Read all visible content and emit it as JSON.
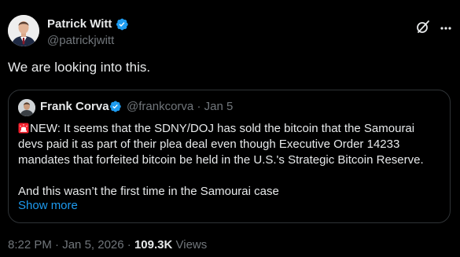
{
  "author": {
    "name": "Patrick Witt",
    "handle": "@patrickjwitt",
    "verified_icon": "verified-badge-icon",
    "avatar_icon": "avatar"
  },
  "header_actions": {
    "grok_icon": "grok-icon",
    "more_icon": "more-icon"
  },
  "tweet": {
    "text": "We are looking into this."
  },
  "quote": {
    "name": "Frank Corva",
    "handle": "@frankcorva",
    "separator": "·",
    "date": "Jan 5",
    "lines": [
      "NEW: It seems that the SDNY/DOJ has sold the bitcoin that the Samourai",
      "devs paid it as part of their plea deal even though Executive Order 14233",
      "mandates that forfeited bitcoin be held in the U.S.'s Strategic Bitcoin Reserve."
    ],
    "line_after_gap": "And this wasn’t the first time in the Samourai case",
    "show_more": "Show more",
    "siren_icon": "siren-icon"
  },
  "meta": {
    "time": "8:22 PM",
    "separator": "·",
    "date": "Jan 5, 2026",
    "views_count": "109.3K",
    "views_label": "Views"
  },
  "colors": {
    "background": "#000000",
    "text_primary": "#e7e9ea",
    "text_secondary": "#71767b",
    "accent": "#1d9bf0",
    "border": "#2f3336",
    "siren": "#f4212e"
  }
}
